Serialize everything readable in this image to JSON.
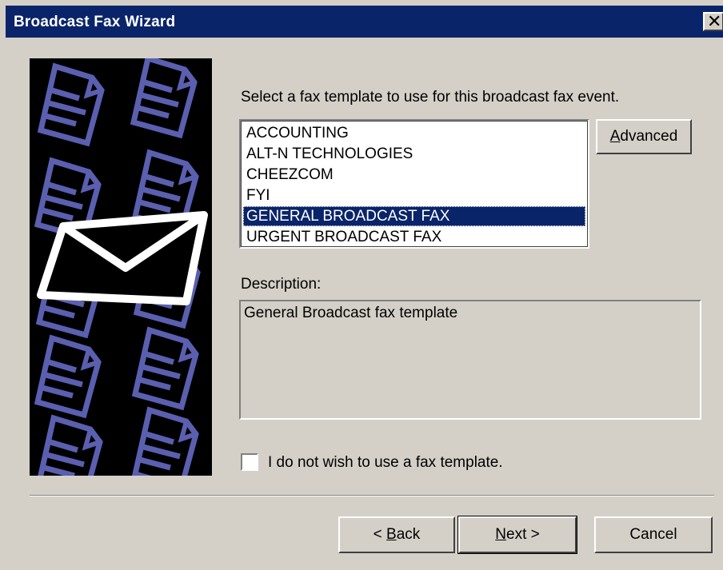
{
  "window": {
    "title": "Broadcast Fax Wizard",
    "close_glyph": "✕"
  },
  "prompt": "Select a fax template to use for this broadcast fax event.",
  "templates": {
    "items": [
      "ACCOUNTING",
      "ALT-N TECHNOLOGIES",
      "CHEEZCOM",
      "FYI",
      "GENERAL BROADCAST FAX",
      "URGENT BROADCAST FAX"
    ],
    "selected_index": 4
  },
  "advanced_button": {
    "accel": "A",
    "rest": "dvanced"
  },
  "description": {
    "label": "Description:",
    "text": "General Broadcast fax template"
  },
  "no_template_checkbox": {
    "label": "I do not wish to use a fax template.",
    "checked": false
  },
  "buttons": {
    "back": {
      "prefix": "< ",
      "accel": "B",
      "rest": "ack"
    },
    "next": {
      "accel": "N",
      "rest": "ext >"
    },
    "cancel": "Cancel"
  },
  "colors": {
    "titlebar": "#0a246a",
    "dialog_face": "#d4d0c8",
    "selection": "#0a246a",
    "art_background": "#000000",
    "art_pattern": "#5a5fb0"
  },
  "icons": {
    "side_art": "document-pattern-with-envelope-icon"
  }
}
